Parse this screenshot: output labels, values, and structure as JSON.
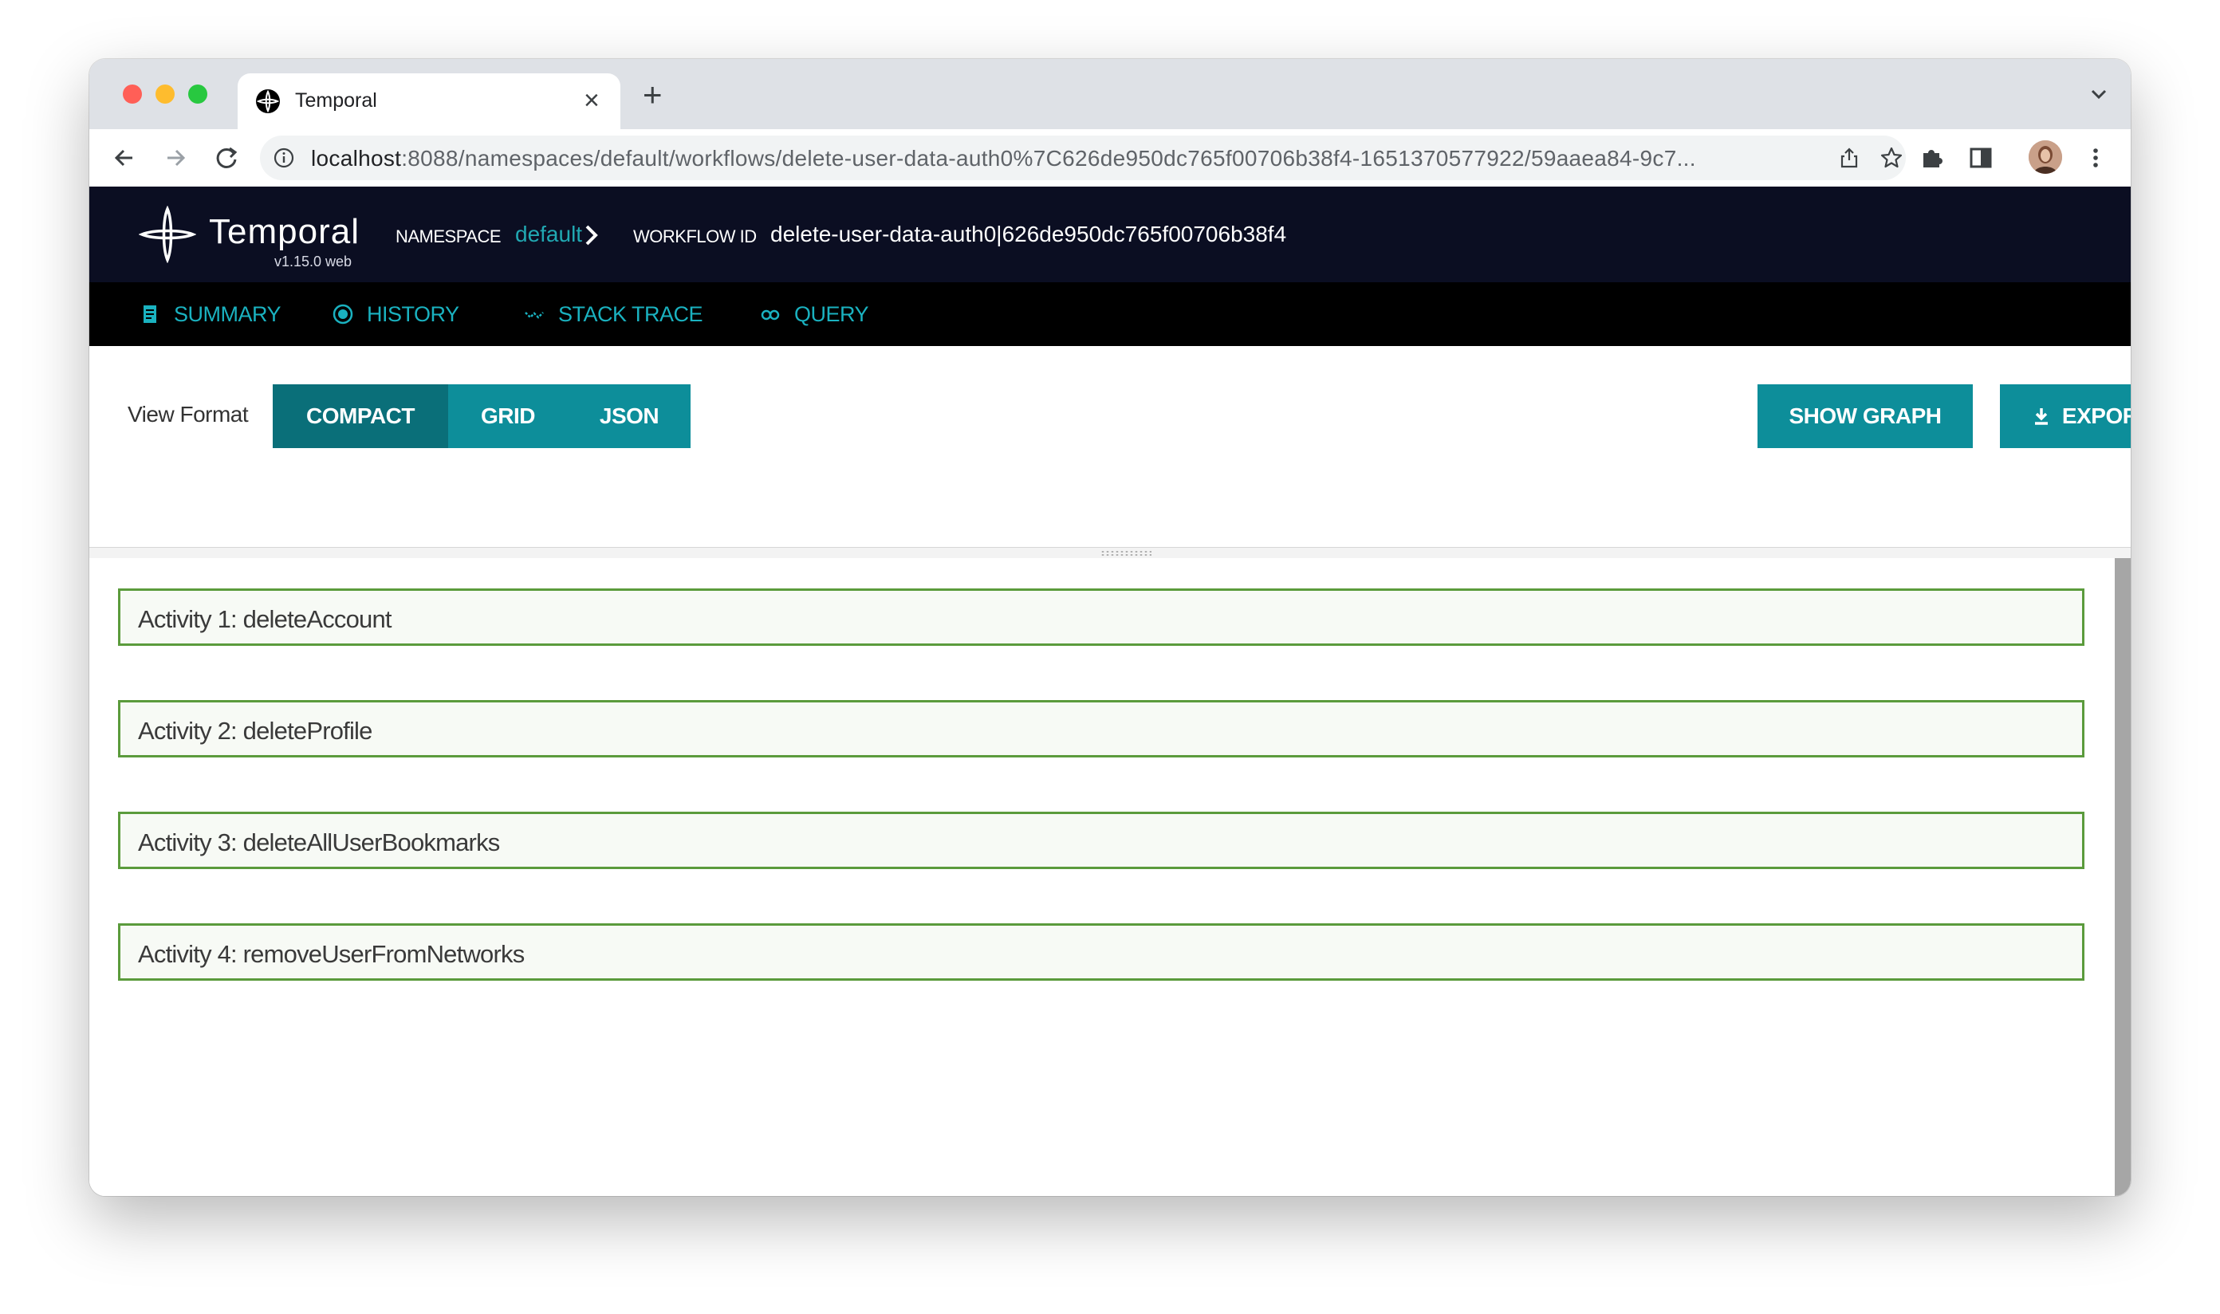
{
  "browser": {
    "tab_title": "Temporal",
    "tab_close": "×",
    "new_tab": "+",
    "url_host": "localhost",
    "url_rest": ":8088/namespaces/default/workflows/delete-user-data-auth0%7C626de950dc765f00706b38f4-1651370577922/59aaea84-9c7..."
  },
  "header": {
    "app_name": "Temporal",
    "version": "v1.15.0 web",
    "namespace_label": "NAMESPACE",
    "namespace_value": "default",
    "workflow_label": "WORKFLOW ID",
    "workflow_value": "delete-user-data-auth0|626de950dc765f00706b38f4"
  },
  "nav": {
    "items": [
      {
        "label": "SUMMARY",
        "icon": "document-icon"
      },
      {
        "label": "HISTORY",
        "icon": "history-icon"
      },
      {
        "label": "STACK TRACE",
        "icon": "stack-trace-icon"
      },
      {
        "label": "QUERY",
        "icon": "query-icon"
      }
    ]
  },
  "toolbar": {
    "view_format_label": "View Format",
    "formats": [
      "COMPACT",
      "GRID",
      "JSON"
    ],
    "active_format": "COMPACT",
    "show_graph": "SHOW GRAPH",
    "export": "EXPORT"
  },
  "activities": [
    "Activity 1: deleteAccount",
    "Activity 2: deleteProfile",
    "Activity 3: deleteAllUserBookmarks",
    "Activity 4: removeUserFromNetworks"
  ],
  "colors": {
    "header_bg": "#0b0e22",
    "nav_bg": "#000000",
    "accent": "#0d8e9a",
    "accent_active": "#0a6f79",
    "nav_text": "#1ab2c0",
    "activity_border": "#5b9b3c"
  }
}
